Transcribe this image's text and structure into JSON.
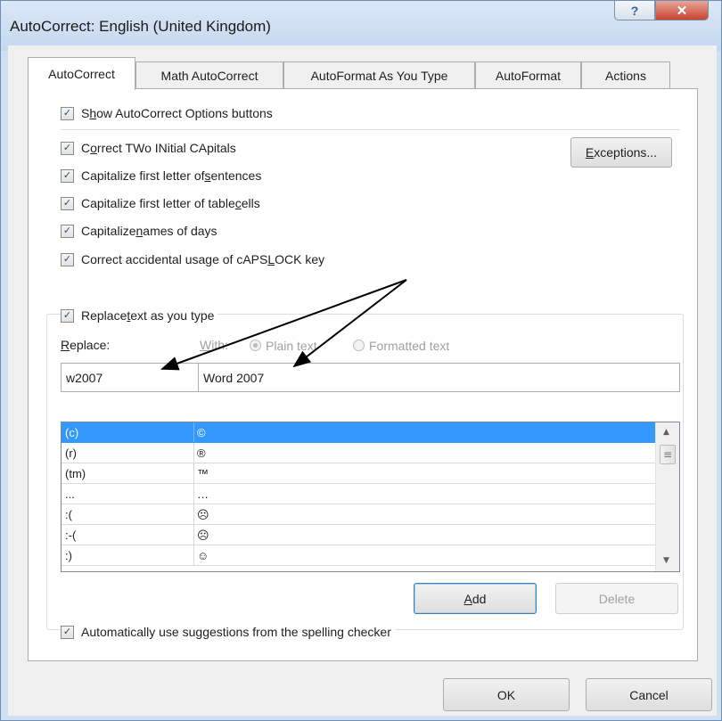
{
  "window": {
    "title": "AutoCorrect: English (United Kingdom)",
    "help_label": "?",
    "close_label": "✕"
  },
  "tabs": [
    {
      "label": "AutoCorrect",
      "active": true
    },
    {
      "label": "Math AutoCorrect",
      "active": false
    },
    {
      "label": "AutoFormat As You Type",
      "active": false
    },
    {
      "label": "AutoFormat",
      "active": false
    },
    {
      "label": "Actions",
      "active": false
    }
  ],
  "options": {
    "show_buttons": {
      "pre": "S",
      "u": "h",
      "post": "ow AutoCorrect Options buttons",
      "checked": true
    },
    "two_initials": {
      "pre": "C",
      "u": "o",
      "post": "rrect TWo INitial CApitals",
      "checked": true
    },
    "first_letter_sentences": {
      "pre": "Capitalize first letter of ",
      "u": "s",
      "post": "entences",
      "checked": true
    },
    "first_letter_cells": {
      "pre": "Capitalize first letter of table ",
      "u": "c",
      "post": "ells",
      "checked": true
    },
    "names_of_days": {
      "pre": "Capitalize ",
      "u": "n",
      "post": "ames of days",
      "checked": true
    },
    "caps_lock": {
      "pre": "Correct accidental usage of cAPS ",
      "u": "L",
      "post": "OCK key",
      "checked": true
    }
  },
  "exceptions_button": {
    "pre": "",
    "u": "E",
    "post": "xceptions..."
  },
  "replace_group": {
    "replace_as_you_type": {
      "pre": "Replace ",
      "u": "t",
      "post": "ext as you type",
      "checked": true
    },
    "replace_label": {
      "pre": "",
      "u": "R",
      "post": "eplace:"
    },
    "with_label": {
      "pre": "",
      "u": "W",
      "post": "ith:"
    },
    "plain_text": "Plain text",
    "formatted_text": "Formatted text",
    "replace_value": "w2007",
    "with_value": "Word 2007"
  },
  "entries": [
    {
      "replace": "(c)",
      "with": "©",
      "selected": true
    },
    {
      "replace": "(r)",
      "with": "®",
      "selected": false
    },
    {
      "replace": "(tm)",
      "with": "™",
      "selected": false
    },
    {
      "replace": "...",
      "with": "…",
      "selected": false
    },
    {
      "replace": ":(",
      "with": "☹",
      "selected": false
    },
    {
      "replace": ":-(",
      "with": "☹",
      "selected": false
    },
    {
      "replace": ":)",
      "with": "☺",
      "selected": false
    }
  ],
  "add_button": {
    "pre": "",
    "u": "A",
    "post": "dd"
  },
  "delete_button": "Delete",
  "suggestions": {
    "pre": "Automatically use su",
    "u": "g",
    "post": "gestions from the spelling checker",
    "checked": true
  },
  "ok_button": "OK",
  "cancel_button": "Cancel",
  "icons": {
    "check": "✓",
    "scroll_up": "▲",
    "scroll_down": "▼",
    "grip": "≡"
  },
  "colors": {
    "selection": "#3399ff",
    "arrow": "#000000"
  }
}
